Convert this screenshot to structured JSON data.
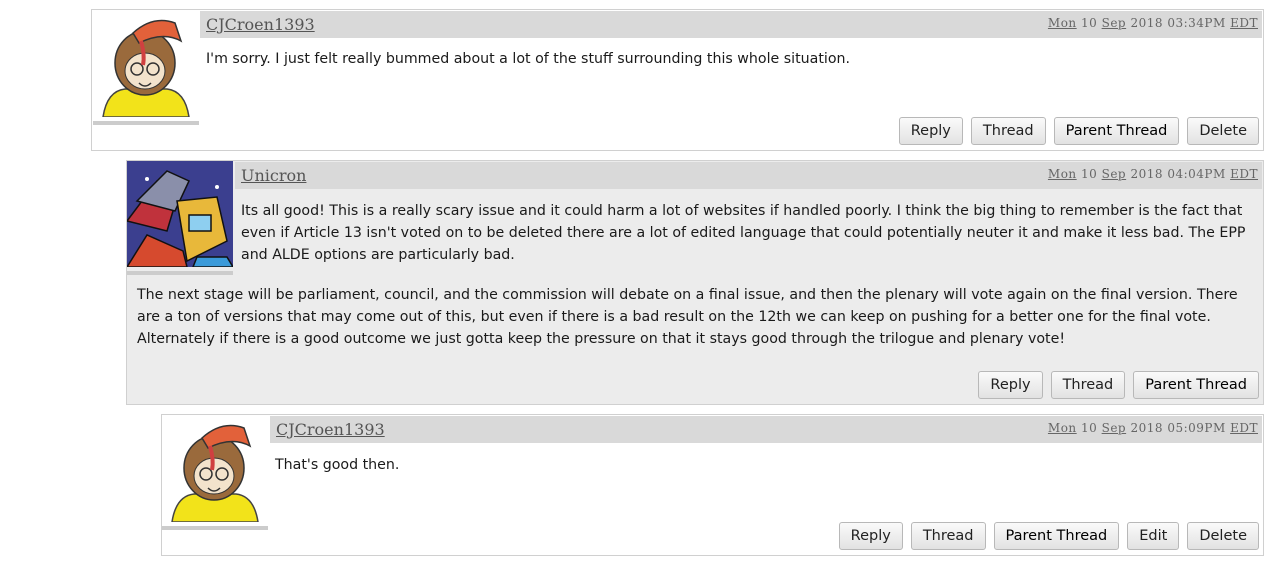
{
  "posts": [
    {
      "username": "CJCroen1393",
      "date": {
        "day": "Mon",
        "num": "10",
        "month": "Sep",
        "year": "2018",
        "time": "03:34PM",
        "tz": "EDT"
      },
      "paragraphs": [
        "I'm sorry. I just felt really bummed about a lot of the stuff surrounding this whole situation."
      ],
      "buttons": [
        "Reply",
        "Thread",
        "Parent Thread",
        "Delete"
      ]
    },
    {
      "username": "Unicron",
      "date": {
        "day": "Mon",
        "num": "10",
        "month": "Sep",
        "year": "2018",
        "time": "04:04PM",
        "tz": "EDT"
      },
      "paragraphs": [
        "Its all good! This is a really scary issue and it could harm a lot of websites if handled poorly. I think the big thing to remember is the fact that even if Article 13 isn't voted on to be deleted there are a lot of edited language that could potentially neuter it and make it less bad. The EPP and ALDE options are particularly bad.",
        "The next stage will be parliament, council, and the commission will debate on a final issue, and then the plenary will vote again on the final version. There are a ton of versions that may come out of this, but even if there is a bad result on the 12th we can keep on pushing for a better one for the final vote. Alternately if there is a good outcome we just gotta keep the pressure on that it stays good through the trilogue and plenary vote!"
      ],
      "buttons": [
        "Reply",
        "Thread",
        "Parent Thread"
      ]
    },
    {
      "username": "CJCroen1393",
      "date": {
        "day": "Mon",
        "num": "10",
        "month": "Sep",
        "year": "2018",
        "time": "05:09PM",
        "tz": "EDT"
      },
      "paragraphs": [
        "That's good then."
      ],
      "buttons": [
        "Reply",
        "Thread",
        "Parent Thread",
        "Edit",
        "Delete"
      ]
    }
  ]
}
